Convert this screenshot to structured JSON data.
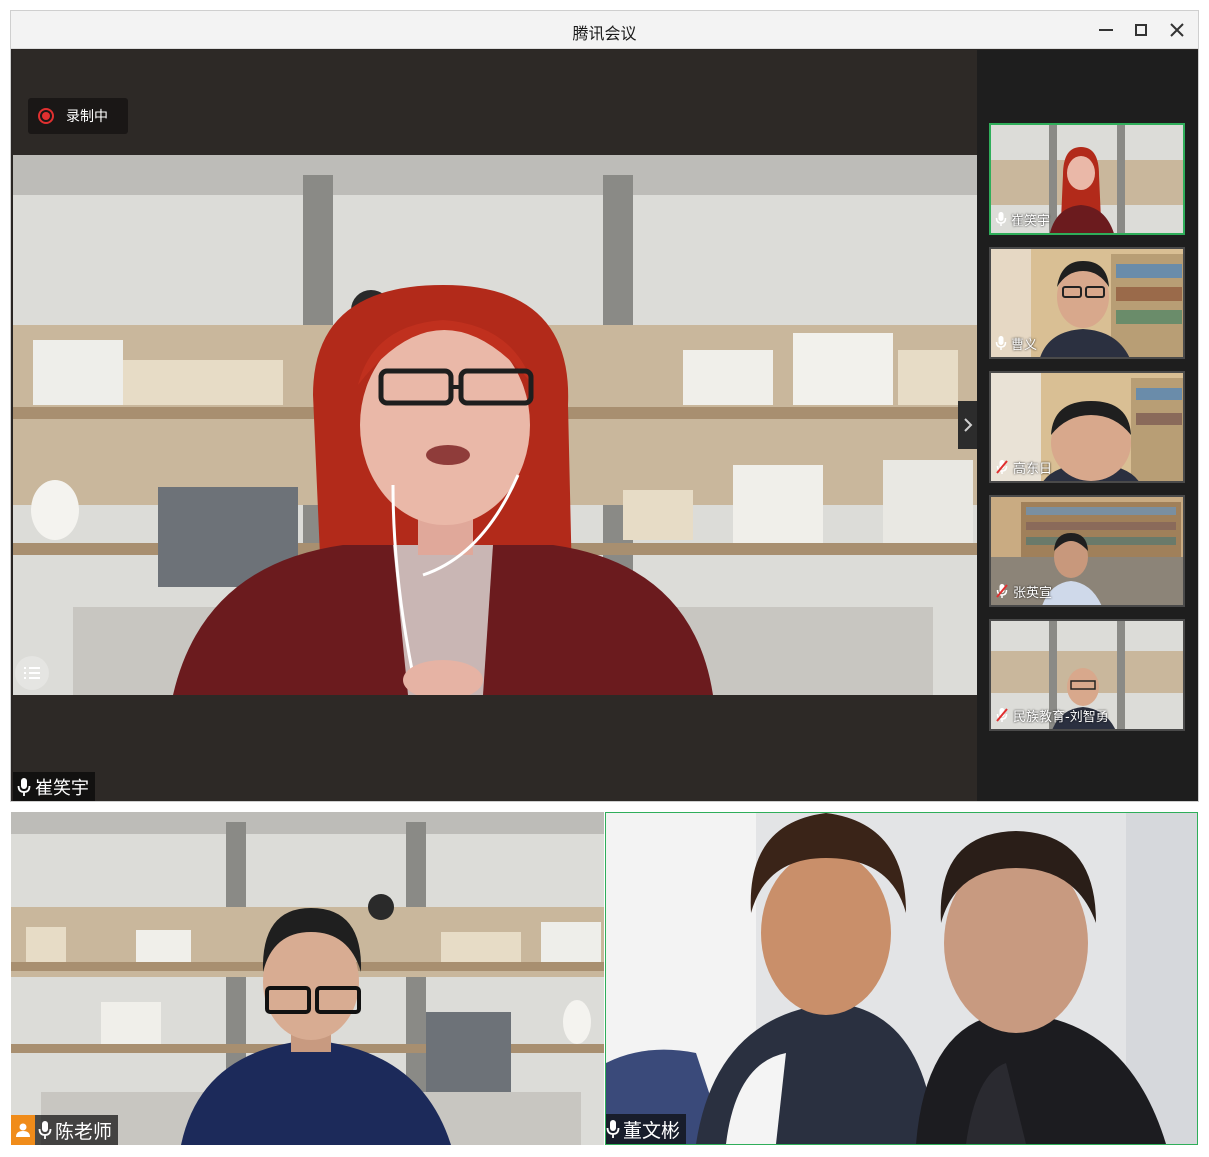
{
  "window": {
    "title": "腾讯会议"
  },
  "recording": {
    "label": "录制中",
    "color": "#e03030"
  },
  "main_speaker": {
    "name": "崔笑宇",
    "mic": "on"
  },
  "participants_panel": [
    {
      "name": "崔笑宇",
      "mic": "on",
      "active": true
    },
    {
      "name": "曹义",
      "mic": "on",
      "active": false
    },
    {
      "name": "高东日",
      "mic": "muted",
      "active": false
    },
    {
      "name": "张英宣",
      "mic": "muted",
      "active": false
    },
    {
      "name": "民族教育-刘智勇",
      "mic": "muted",
      "active": false
    }
  ],
  "gallery": [
    {
      "name": "陈老师",
      "mic": "on",
      "host": true
    },
    {
      "name": "董文彬",
      "mic": "on",
      "host": false
    }
  ],
  "colors": {
    "active_border": "#2fae5a",
    "host_badge": "#f08c1a",
    "muted": "#e03030"
  }
}
